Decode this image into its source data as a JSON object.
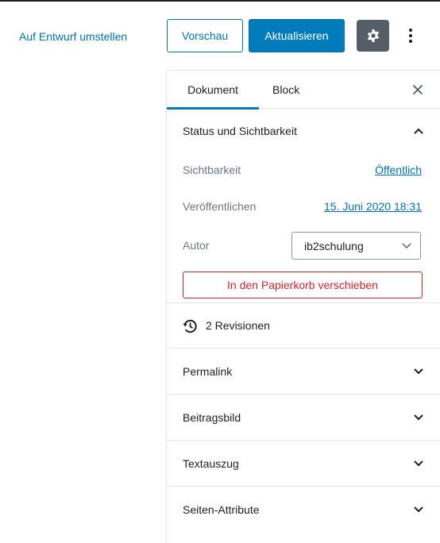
{
  "header": {
    "switch_to_draft": "Auf Entwurf umstellen",
    "preview": "Vorschau",
    "update": "Aktualisieren",
    "settings_icon": "gear-icon",
    "more_icon": "vertical-ellipsis-icon"
  },
  "sidebar": {
    "tabs": [
      {
        "label": "Dokument",
        "active": true
      },
      {
        "label": "Block",
        "active": false
      }
    ],
    "close_icon": "close-icon",
    "status": {
      "title": "Status und Sichtbarkeit",
      "expanded": true,
      "visibility_label": "Sichtbarkeit",
      "visibility_value": "Öffentlich",
      "publish_label": "Veröffentlichen",
      "publish_value": "15. Juni 2020 18:31",
      "author_label": "Autor",
      "author_value": "ib2schulung",
      "trash_button": "In den Papierkorb verschieben"
    },
    "revisions": {
      "icon": "history-icon",
      "label": "2 Revisionen"
    },
    "panels": [
      {
        "title": "Permalink"
      },
      {
        "title": "Beitragsbild"
      },
      {
        "title": "Textauszug"
      },
      {
        "title": "Seiten-Attribute"
      }
    ]
  },
  "colors": {
    "accent": "#007cba",
    "link": "#0073aa",
    "danger": "#c9272d",
    "settings_bg": "#555d66"
  }
}
